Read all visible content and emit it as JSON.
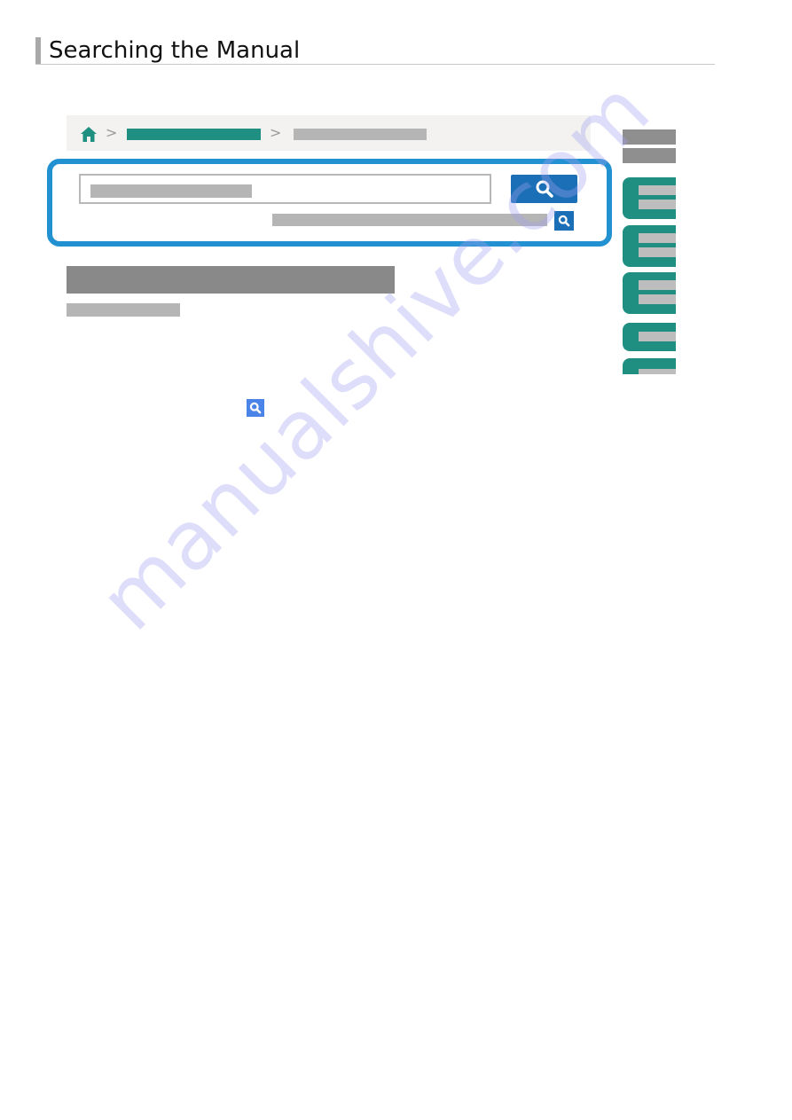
{
  "heading": {
    "title": "Searching the Manual"
  },
  "illustration": {
    "breadcrumb": {
      "home_icon": "home-icon",
      "separator": ">",
      "items": [
        "link-placeholder",
        "current-placeholder"
      ]
    },
    "search": {
      "button_icon": "search-icon",
      "advanced_icon": "search-icon"
    },
    "sidebar": {
      "gray_items": 2,
      "cards": 5
    }
  },
  "inline_icon": "search-icon",
  "colors": {
    "accent_blue": "#2291d2",
    "button_blue": "#1a6fb6",
    "teal": "#1e8f80",
    "placeholder_gray": "#b5b5b5",
    "title_gray": "#898989"
  },
  "watermark": {
    "text": "manualshive.com"
  }
}
